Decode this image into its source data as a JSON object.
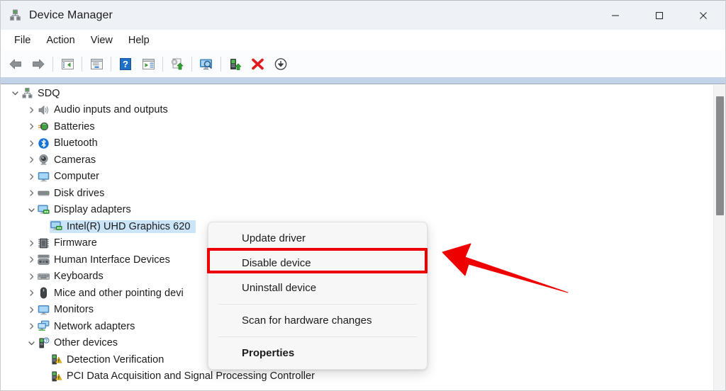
{
  "window": {
    "title": "Device Manager",
    "app_icon": "device-manager-icon",
    "controls": {
      "minimize": "minimize-icon",
      "maximize": "maximize-icon",
      "close": "close-icon"
    }
  },
  "menubar": {
    "items": [
      {
        "label": "File"
      },
      {
        "label": "Action"
      },
      {
        "label": "View"
      },
      {
        "label": "Help"
      }
    ]
  },
  "toolbar": {
    "buttons": [
      {
        "name": "back-arrow-icon",
        "title": "Back"
      },
      {
        "name": "forward-arrow-icon",
        "title": "Forward"
      },
      {
        "name": "show-hide-console-tree-icon",
        "title": "Show/Hide Console Tree"
      },
      {
        "name": "properties-icon",
        "title": "Properties"
      },
      {
        "name": "help-icon",
        "title": "Help"
      },
      {
        "name": "view-devices-icon",
        "title": "View Devices"
      },
      {
        "name": "update-driver-icon",
        "title": "Update Driver Software"
      },
      {
        "name": "scan-hardware-changes-icon",
        "title": "Scan for hardware changes"
      },
      {
        "name": "enable-device-icon",
        "title": "Enable device"
      },
      {
        "name": "uninstall-device-icon",
        "title": "Uninstall device"
      },
      {
        "name": "disable-device-icon",
        "title": "Disable device"
      }
    ]
  },
  "tree": {
    "rows": [
      {
        "label": "SDQ",
        "depth": 0,
        "state": "expanded",
        "icon": "computer-root-icon",
        "selected": false
      },
      {
        "label": "Audio inputs and outputs",
        "depth": 1,
        "state": "collapsed",
        "icon": "speaker-icon",
        "selected": false
      },
      {
        "label": "Batteries",
        "depth": 1,
        "state": "collapsed",
        "icon": "battery-icon",
        "selected": false
      },
      {
        "label": "Bluetooth",
        "depth": 1,
        "state": "collapsed",
        "icon": "bluetooth-icon",
        "selected": false
      },
      {
        "label": "Cameras",
        "depth": 1,
        "state": "collapsed",
        "icon": "camera-icon",
        "selected": false
      },
      {
        "label": "Computer",
        "depth": 1,
        "state": "collapsed",
        "icon": "monitor-icon",
        "selected": false
      },
      {
        "label": "Disk drives",
        "depth": 1,
        "state": "collapsed",
        "icon": "disk-drive-icon",
        "selected": false
      },
      {
        "label": "Display adapters",
        "depth": 1,
        "state": "expanded",
        "icon": "display-adapter-icon",
        "selected": false
      },
      {
        "label": "Intel(R) UHD Graphics 620",
        "depth": 2,
        "state": "leaf",
        "icon": "display-adapter-icon",
        "selected": true
      },
      {
        "label": "Firmware",
        "depth": 1,
        "state": "collapsed",
        "icon": "firmware-icon",
        "selected": false
      },
      {
        "label": "Human Interface Devices",
        "depth": 1,
        "state": "collapsed",
        "icon": "hid-icon",
        "selected": false
      },
      {
        "label": "Keyboards",
        "depth": 1,
        "state": "collapsed",
        "icon": "keyboard-icon",
        "selected": false
      },
      {
        "label": "Mice and other pointing devi",
        "depth": 1,
        "state": "collapsed",
        "icon": "mouse-icon",
        "selected": false
      },
      {
        "label": "Monitors",
        "depth": 1,
        "state": "collapsed",
        "icon": "monitor-icon",
        "selected": false
      },
      {
        "label": "Network adapters",
        "depth": 1,
        "state": "collapsed",
        "icon": "network-adapter-icon",
        "selected": false
      },
      {
        "label": "Other devices",
        "depth": 1,
        "state": "expanded",
        "icon": "unknown-device-icon",
        "selected": false
      },
      {
        "label": "Detection Verification",
        "depth": 2,
        "state": "leaf",
        "icon": "warning-device-icon",
        "selected": false
      },
      {
        "label": "PCI Data Acquisition and Signal Processing Controller",
        "depth": 2,
        "state": "leaf",
        "icon": "warning-device-icon",
        "selected": false
      }
    ]
  },
  "context_menu": {
    "items": [
      {
        "label": "Update driver",
        "bold": false,
        "separator_after": false
      },
      {
        "label": "Disable device",
        "bold": false,
        "separator_after": false,
        "highlighted": true
      },
      {
        "label": "Uninstall device",
        "bold": false,
        "separator_after": true
      },
      {
        "label": "Scan for hardware changes",
        "bold": false,
        "separator_after": true
      },
      {
        "label": "Properties",
        "bold": true,
        "separator_after": false
      }
    ]
  },
  "annotation": {
    "highlight_color": "#ee0000",
    "arrow_name": "red-pointer-arrow",
    "target_item": "Disable device"
  },
  "colors": {
    "titlebar_bg": "#eef2f6",
    "selection_bg": "#cce4f7",
    "accent_red": "#ee0000",
    "strip_blue": "#c3d4ea"
  }
}
